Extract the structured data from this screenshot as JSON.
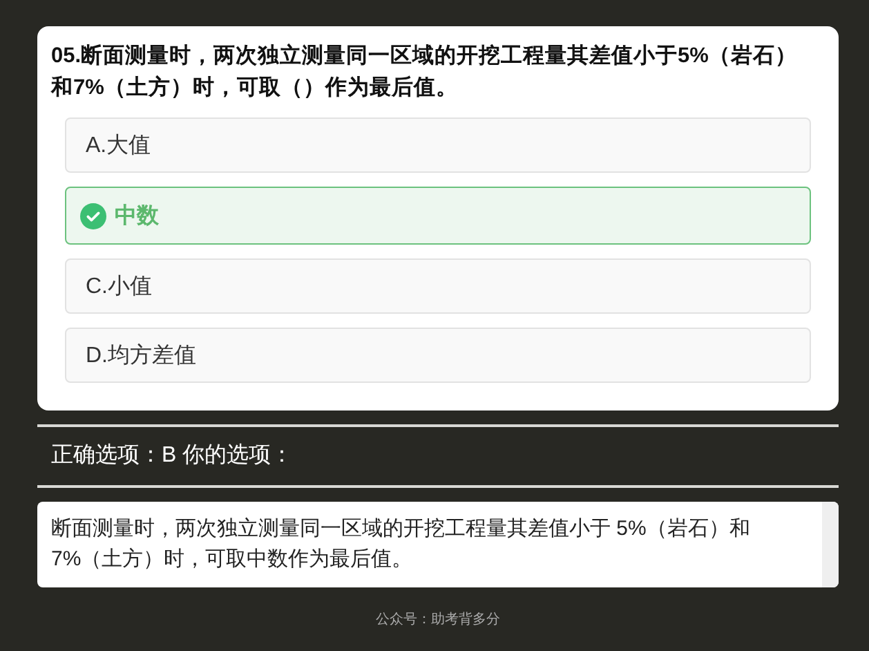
{
  "question": {
    "text": "05.断面测量时，两次独立测量同一区域的开挖工程量其差值小于5%（岩石）和7%（土方）时，可取（）作为最后值。",
    "options": [
      {
        "letter": "A.",
        "text": "大值",
        "selected": false
      },
      {
        "text": "中数",
        "selected": true
      },
      {
        "letter": "C.",
        "text": "小值",
        "selected": false
      },
      {
        "letter": "D.",
        "text": "均方差值",
        "selected": false
      }
    ]
  },
  "answer_line": "正确选项：B 你的选项：",
  "explanation": "断面测量时，两次独立测量同一区域的开挖工程量其差值小于 5%（岩石）和 7%（土方）时，可取中数作为最后值。",
  "footer": "公众号：助考背多分"
}
